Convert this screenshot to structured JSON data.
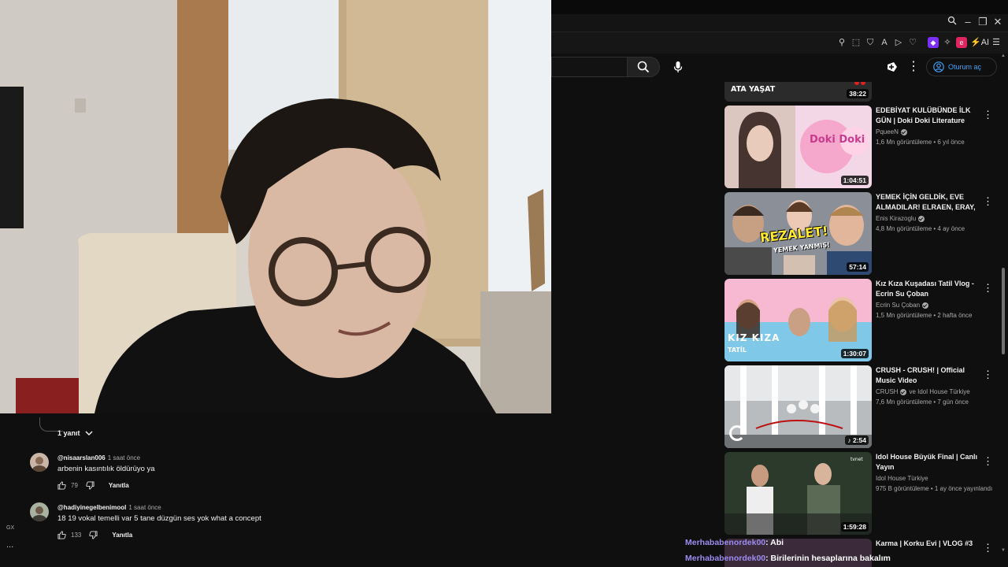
{
  "browser": {
    "ai_label": "AI"
  },
  "header": {
    "signin_label": "Oturum aç"
  },
  "comments": {
    "replies_label": "1 yanıt",
    "items": [
      {
        "user": "@nisaarslan006",
        "time": "1 saat önce",
        "text": "arbenin kasıntılık öldürüyo ya",
        "likes": "79",
        "reply_label": "Yanıtla"
      },
      {
        "user": "@hadiyinegelbenimool",
        "time": "1 saat önce",
        "text": "18 19 vokal temelli var 5 tane düzgün ses yok what a concept",
        "likes": "133",
        "reply_label": "Yanıtla"
      }
    ]
  },
  "left_rail": {
    "gx_label": "GX",
    "more_label": "..."
  },
  "sidebar": {
    "videos": [
      {
        "title": "",
        "channel": "",
        "meta": "",
        "duration": "38:22",
        "thumb_text": "ATA YAŞAT"
      },
      {
        "title": "EDEBİYAT KULÜBÜNDE İLK GÜN | Doki Doki Literature Clu...",
        "channel": "PqueeN",
        "verified": true,
        "meta": "1,6 Mn görüntüleme • 6 yıl önce",
        "duration": "1:04:51",
        "thumb_text": "Doki Doki"
      },
      {
        "title": "YEMEK İÇİN GELDİK, EVE ALMADILAR! ELRAEN, ERAY, ...",
        "channel": "Enis Kirazoglu",
        "verified": true,
        "meta": "4,8 Mn görüntüleme • 4 ay önce",
        "duration": "57:14",
        "thumb_text": "REZALET!",
        "thumb_text2": "YEMEK YANMIŞ!"
      },
      {
        "title": "Kız Kıza Kuşadası Tatil Vlog - Ecrin Su Çoban",
        "channel": "Ecrin Su Çoban",
        "verified": true,
        "meta": "1,5 Mn görüntüleme • 2 hafta önce",
        "duration": "1:30:07",
        "thumb_text": "KIZ KIZA",
        "thumb_text2": "TATİL"
      },
      {
        "title": "CRUSH - CRUSH! | Official Music Video",
        "channel": "CRUSH",
        "channel_extra": "ve Idol House Türkiye",
        "verified": true,
        "meta": "7,6 Mn görüntüleme • 7 gün önce",
        "duration": "2:54",
        "thumb_text": ""
      },
      {
        "title": "Idol House Büyük Final | Canlı Yayın",
        "channel": "Idol House Türkiye",
        "verified": false,
        "meta": "975 B görüntüleme • 1 ay önce yayınlandı",
        "duration": "1:59:28",
        "thumb_text": "tvnet"
      },
      {
        "title": "Karma | Korku Evi | VLOG #3",
        "channel": "",
        "meta": "",
        "duration": "",
        "thumb_text": ""
      }
    ]
  },
  "chat": [
    {
      "name": "Merhababenordek00",
      "msg": ": Abi"
    },
    {
      "name": "Merhababenordek00",
      "msg": ": Birilerinin hesaplarına bakalım"
    }
  ]
}
